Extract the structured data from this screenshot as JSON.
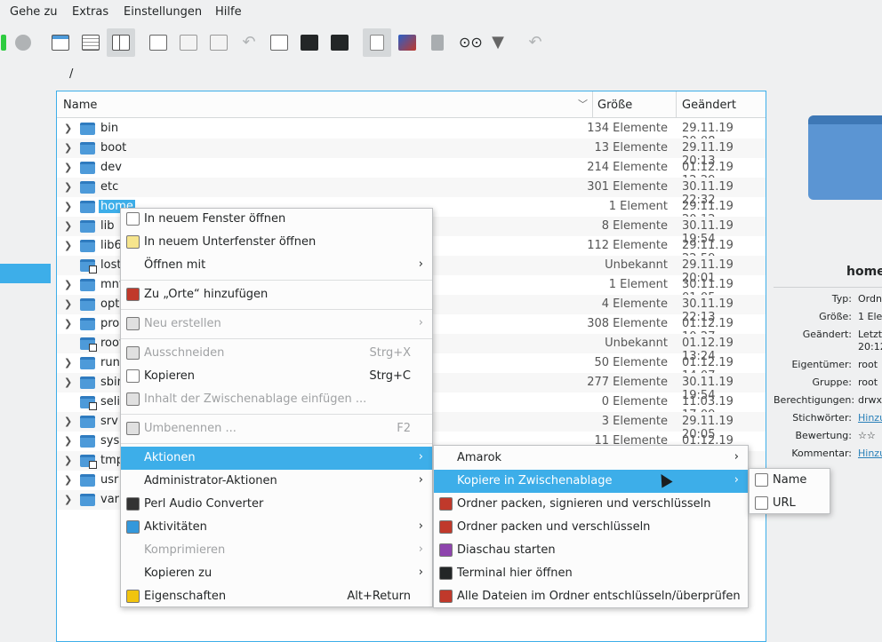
{
  "menubar": [
    "Gehe zu",
    "Extras",
    "Einstellungen",
    "Hilfe"
  ],
  "toolbar_icons": [
    "stop-icon",
    "icon-view-icon",
    "details-view-icon",
    "columns-view-icon",
    "new-tab-icon",
    "new-folder-icon",
    "new-file-icon",
    "undo-icon",
    "add-icon",
    "terminal-icon",
    "terminal-2-icon",
    "preview-icon",
    "image-icon",
    "trash-icon",
    "find-icon",
    "filter-icon",
    "redo-icon"
  ],
  "breadcrumb": "/",
  "columns": {
    "name": "Name",
    "size": "Größe",
    "modified": "Geändert"
  },
  "rows": [
    {
      "name": "bin",
      "size": "134 Elemente",
      "date": "29.11.19 20:08"
    },
    {
      "name": "boot",
      "size": "13 Elemente",
      "date": "29.11.19 20:13"
    },
    {
      "name": "dev",
      "size": "214 Elemente",
      "date": "01.12.19 12:29"
    },
    {
      "name": "etc",
      "size": "301 Elemente",
      "date": "30.11.19 22:32"
    },
    {
      "name": "home",
      "size": "1 Element",
      "date": "29.11.19 20:12"
    },
    {
      "name": "lib",
      "size": "8 Elemente",
      "date": "30.11.19 19:54"
    },
    {
      "name": "lib64",
      "size": "112 Elemente",
      "date": "29.11.19 22:59"
    },
    {
      "name": "lost+found",
      "size": "Unbekannt",
      "date": "29.11.19 20:01"
    },
    {
      "name": "mnt",
      "size": "1 Element",
      "date": "30.11.19 01:05"
    },
    {
      "name": "opt",
      "size": "4 Elemente",
      "date": "30.11.19 22:13"
    },
    {
      "name": "proc",
      "size": "308 Elemente",
      "date": "01.12.19 10:27"
    },
    {
      "name": "root",
      "size": "Unbekannt",
      "date": "01.12.19 13:24"
    },
    {
      "name": "run",
      "size": "50 Elemente",
      "date": "01.12.19 14:07"
    },
    {
      "name": "sbin",
      "size": "277 Elemente",
      "date": "30.11.19 19:54"
    },
    {
      "name": "selinux",
      "size": "0 Elemente",
      "date": "11.03.19 17:09"
    },
    {
      "name": "srv",
      "size": "3 Elemente",
      "date": "29.11.19 20:05"
    },
    {
      "name": "sys",
      "size": "11 Elemente",
      "date": "01.12.19 10:27"
    },
    {
      "name": "tmp",
      "size": "",
      "date": "07"
    },
    {
      "name": "usr",
      "size": "",
      "date": ""
    },
    {
      "name": "var",
      "size": "",
      "date": ""
    }
  ],
  "info": {
    "name": "home",
    "fields": [
      {
        "k": "Typ:",
        "v": "Ordn"
      },
      {
        "k": "Größe:",
        "v": "1 Elen"
      },
      {
        "k": "Geändert:",
        "v": "Letzt"
      },
      {
        "k": "",
        "v": "20:12"
      },
      {
        "k": "Eigentümer:",
        "v": "root"
      },
      {
        "k": "Gruppe:",
        "v": "root"
      },
      {
        "k": "Berechtigungen:",
        "v": "drwxr"
      },
      {
        "k": "Stichwörter:",
        "v": "Hinzu"
      },
      {
        "k": "Bewertung:",
        "v": "☆☆"
      },
      {
        "k": "Kommentar:",
        "v": "Hinzu"
      }
    ]
  },
  "context_menu": [
    {
      "label": "In neuem Fenster öffnen",
      "icon": "new-window-icon"
    },
    {
      "label": "In neuem Unterfenster öffnen",
      "icon": "new-tab-icon"
    },
    {
      "label": "Öffnen mit",
      "submenu": true
    },
    {
      "label": "Zu „Orte“ hinzufügen",
      "icon": "bookmark-add-icon"
    },
    {
      "label": "Neu erstellen",
      "submenu": true,
      "disabled": true,
      "icon": "new-icon"
    },
    {
      "label": "Ausschneiden",
      "shortcut": "Strg+X",
      "disabled": true,
      "icon": "cut-icon"
    },
    {
      "label": "Kopieren",
      "shortcut": "Strg+C",
      "icon": "copy-icon"
    },
    {
      "label": "Inhalt der Zwischenablage einfügen ...",
      "disabled": true,
      "icon": "paste-icon"
    },
    {
      "label": "Umbenennen ...",
      "shortcut": "F2",
      "disabled": true,
      "icon": "rename-icon"
    },
    {
      "label": "Aktionen",
      "submenu": true,
      "highlight": true
    },
    {
      "label": "Administrator-Aktionen",
      "submenu": true
    },
    {
      "label": "Perl Audio Converter",
      "icon": "audio-converter-icon"
    },
    {
      "label": "Aktivitäten",
      "submenu": true,
      "icon": "activities-icon"
    },
    {
      "label": "Komprimieren",
      "submenu": true,
      "disabled": true
    },
    {
      "label": "Kopieren zu",
      "submenu": true
    },
    {
      "label": "Eigenschaften",
      "shortcut": "Alt+Return",
      "icon": "properties-icon"
    }
  ],
  "actions_menu": [
    {
      "label": "Amarok",
      "submenu": true
    },
    {
      "label": "Kopiere in Zwischenablage",
      "submenu": true,
      "highlight": true
    },
    {
      "label": "Ordner packen, signieren und verschlüsseln",
      "icon": "gpg-icon"
    },
    {
      "label": "Ordner packen und verschlüsseln",
      "icon": "gpg-icon"
    },
    {
      "label": "Diaschau starten",
      "icon": "slideshow-icon"
    },
    {
      "label": "Terminal hier öffnen",
      "icon": "terminal-icon"
    },
    {
      "label": "Alle Dateien im Ordner entschlüsseln/überprüfen",
      "icon": "gpg-icon"
    }
  ],
  "clipboard_menu": [
    {
      "label": "Name",
      "icon": "clipboard-icon"
    },
    {
      "label": "URL",
      "icon": "clipboard-icon"
    }
  ],
  "colors": {
    "accent": "#3daee9",
    "folder": "#4d9ad9"
  }
}
